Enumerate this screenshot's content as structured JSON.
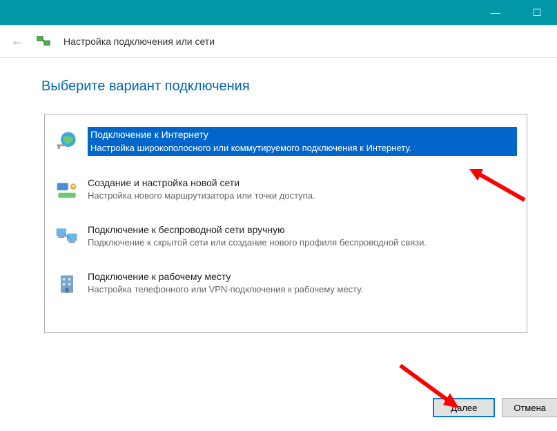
{
  "window": {
    "title": "Настройка подключения или сети"
  },
  "page": {
    "heading": "Выберите вариант подключения"
  },
  "options": [
    {
      "title": "Подключение к Интернету",
      "desc": "Настройка широкополосного или коммутируемого подключения к Интернету.",
      "selected": true
    },
    {
      "title": "Создание и настройка новой сети",
      "desc": "Настройка нового маршрутизатора или точки доступа."
    },
    {
      "title": "Подключение к беспроводной сети вручную",
      "desc": "Подключение к скрытой сети или создание нового профиля беспроводной связи."
    },
    {
      "title": "Подключение к рабочему месту",
      "desc": "Настройка телефонного или VPN-подключения к рабочему месту."
    }
  ],
  "buttons": {
    "next": "Далее",
    "cancel": "Отмена"
  }
}
